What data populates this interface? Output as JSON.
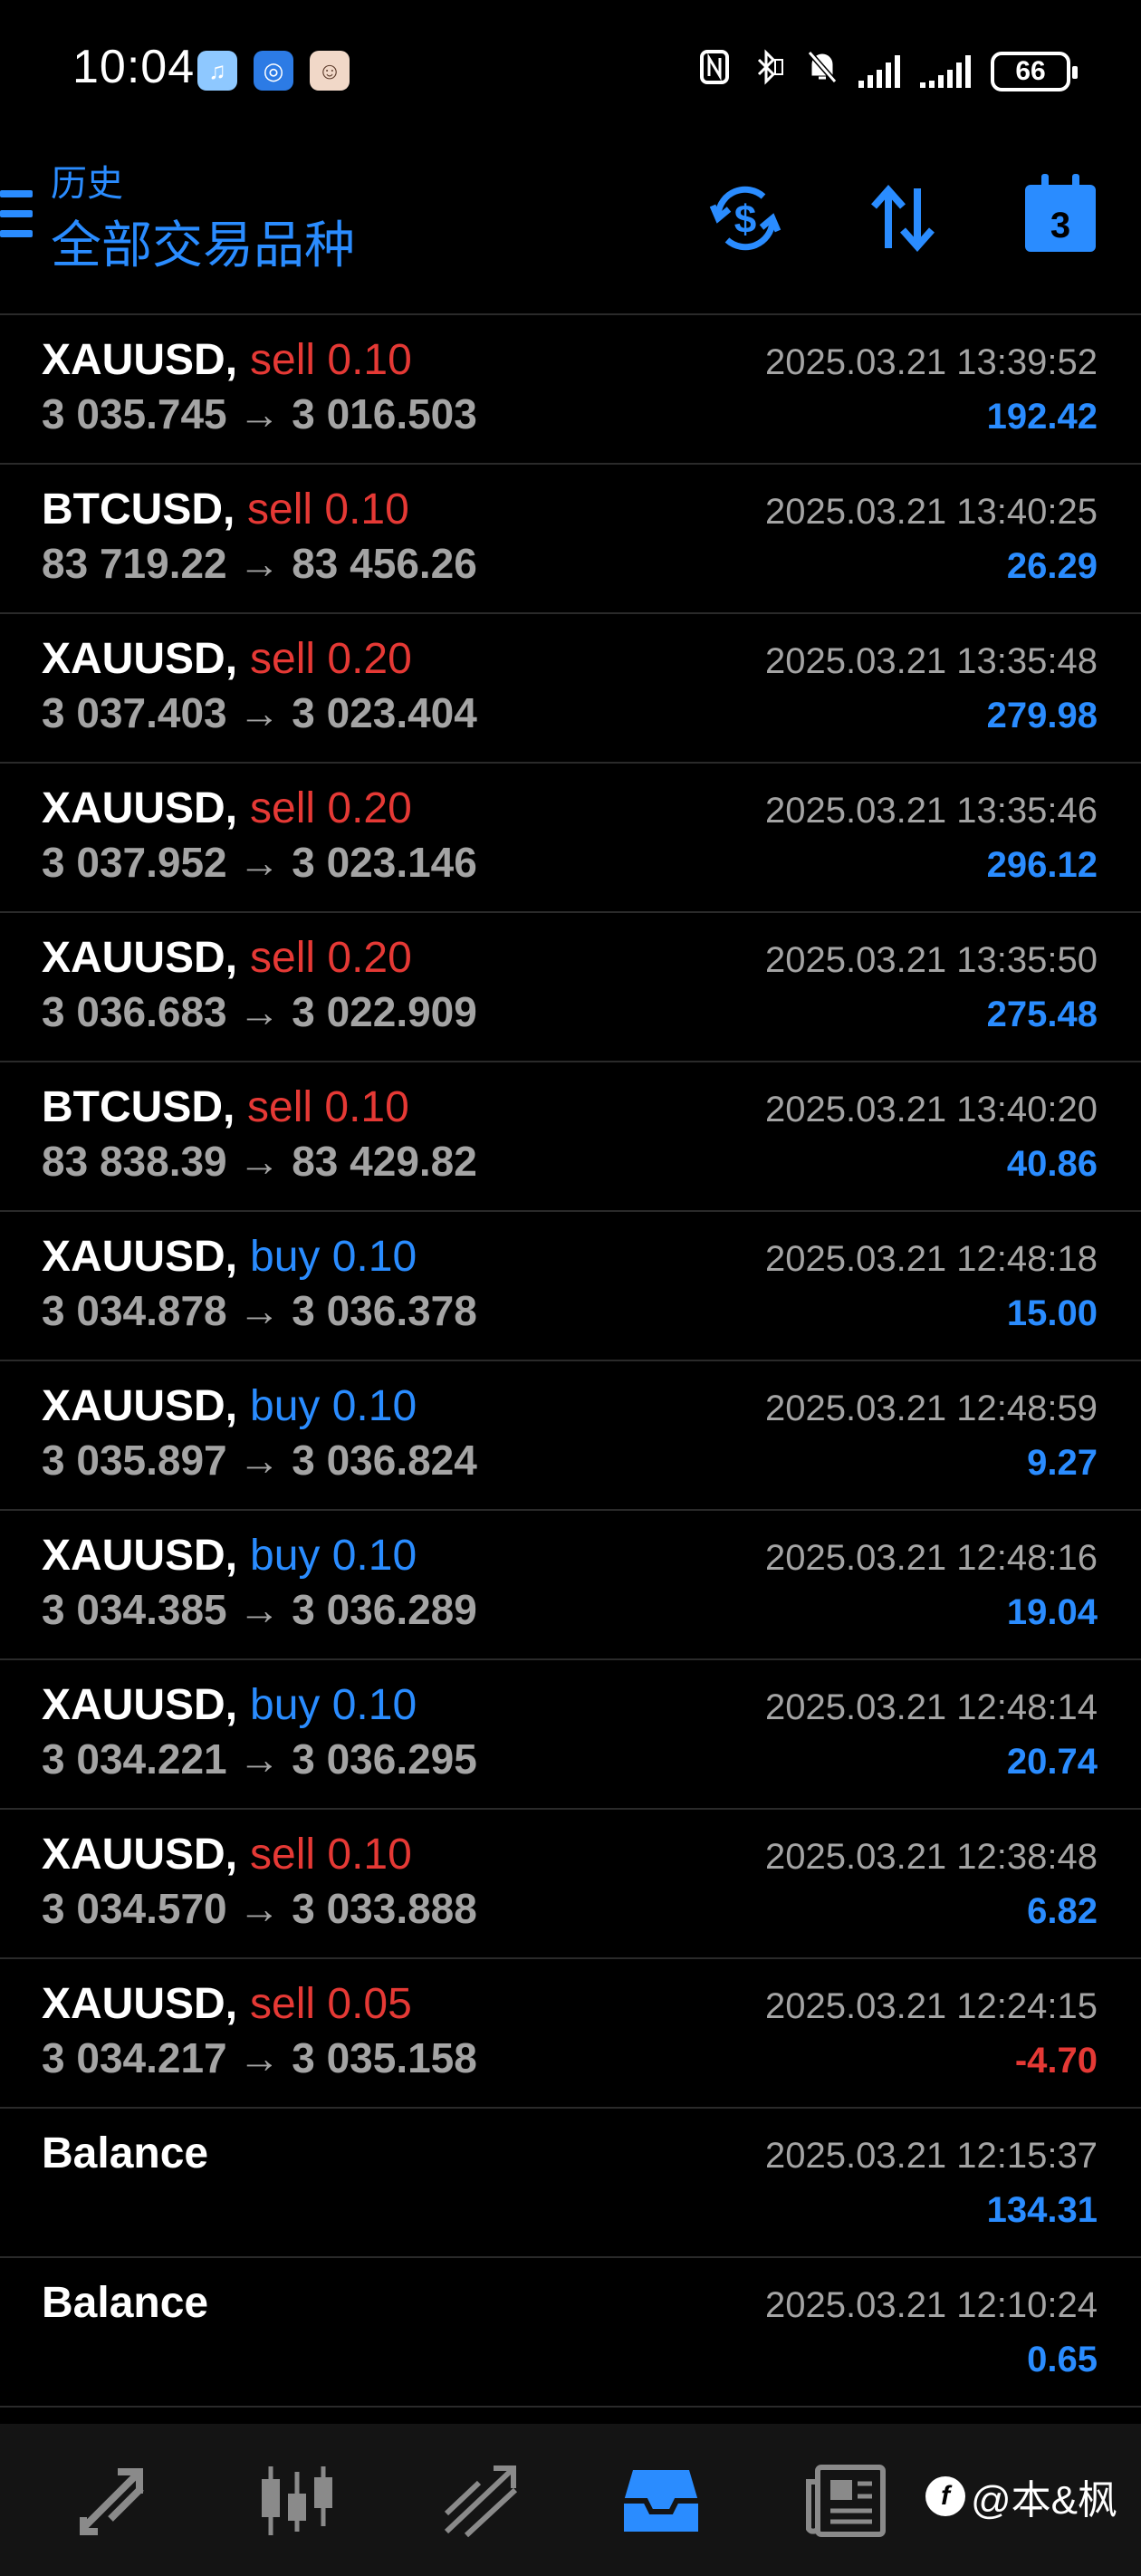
{
  "status_bar": {
    "time": "10:04",
    "battery": "66"
  },
  "header": {
    "subtitle": "历史",
    "title": "全部交易品种",
    "calendar_badge": "3"
  },
  "trades": [
    {
      "symbol": "XAUUSD,",
      "side": "sell",
      "side_type": "sell",
      "volume": "0.10",
      "prices": "3 035.745 → 3 016.503",
      "time": "2025.03.21 13:39:52",
      "profit": "192.42",
      "negative": false
    },
    {
      "symbol": "BTCUSD,",
      "side": "sell",
      "side_type": "sell",
      "volume": "0.10",
      "prices": "83 719.22 → 83 456.26",
      "time": "2025.03.21 13:40:25",
      "profit": "26.29",
      "negative": false
    },
    {
      "symbol": "XAUUSD,",
      "side": "sell",
      "side_type": "sell",
      "volume": "0.20",
      "prices": "3 037.403 → 3 023.404",
      "time": "2025.03.21 13:35:48",
      "profit": "279.98",
      "negative": false
    },
    {
      "symbol": "XAUUSD,",
      "side": "sell",
      "side_type": "sell",
      "volume": "0.20",
      "prices": "3 037.952 → 3 023.146",
      "time": "2025.03.21 13:35:46",
      "profit": "296.12",
      "negative": false
    },
    {
      "symbol": "XAUUSD,",
      "side": "sell",
      "side_type": "sell",
      "volume": "0.20",
      "prices": "3 036.683 → 3 022.909",
      "time": "2025.03.21 13:35:50",
      "profit": "275.48",
      "negative": false
    },
    {
      "symbol": "BTCUSD,",
      "side": "sell",
      "side_type": "sell",
      "volume": "0.10",
      "prices": "83 838.39 → 83 429.82",
      "time": "2025.03.21 13:40:20",
      "profit": "40.86",
      "negative": false
    },
    {
      "symbol": "XAUUSD,",
      "side": "buy",
      "side_type": "buy",
      "volume": "0.10",
      "prices": "3 034.878 → 3 036.378",
      "time": "2025.03.21 12:48:18",
      "profit": "15.00",
      "negative": false
    },
    {
      "symbol": "XAUUSD,",
      "side": "buy",
      "side_type": "buy",
      "volume": "0.10",
      "prices": "3 035.897 → 3 036.824",
      "time": "2025.03.21 12:48:59",
      "profit": "9.27",
      "negative": false
    },
    {
      "symbol": "XAUUSD,",
      "side": "buy",
      "side_type": "buy",
      "volume": "0.10",
      "prices": "3 034.385 → 3 036.289",
      "time": "2025.03.21 12:48:16",
      "profit": "19.04",
      "negative": false
    },
    {
      "symbol": "XAUUSD,",
      "side": "buy",
      "side_type": "buy",
      "volume": "0.10",
      "prices": "3 034.221 → 3 036.295",
      "time": "2025.03.21 12:48:14",
      "profit": "20.74",
      "negative": false
    },
    {
      "symbol": "XAUUSD,",
      "side": "sell",
      "side_type": "sell",
      "volume": "0.10",
      "prices": "3 034.570 → 3 033.888",
      "time": "2025.03.21 12:38:48",
      "profit": "6.82",
      "negative": false
    },
    {
      "symbol": "XAUUSD,",
      "side": "sell",
      "side_type": "sell",
      "volume": "0.05",
      "prices": "3 034.217 → 3 035.158",
      "time": "2025.03.21 12:24:15",
      "profit": "-4.70",
      "negative": true
    },
    {
      "symbol": "Balance",
      "side": "",
      "side_type": "none",
      "volume": "",
      "prices": "",
      "time": "2025.03.21 12:15:37",
      "profit": "134.31",
      "negative": false
    },
    {
      "symbol": "Balance",
      "side": "",
      "side_type": "none",
      "volume": "",
      "prices": "",
      "time": "2025.03.21 12:10:24",
      "profit": "0.65",
      "negative": false
    }
  ],
  "bottom_nav": {
    "items": [
      {
        "icon": "quotes-icon",
        "active": false
      },
      {
        "icon": "chart-icon",
        "active": false
      },
      {
        "icon": "trade-icon",
        "active": false
      },
      {
        "icon": "history-icon",
        "active": true
      },
      {
        "icon": "news-icon",
        "active": false
      }
    ],
    "watermark": "@本&枫"
  },
  "colors": {
    "accent": "#2a8cff",
    "sell": "#e53935",
    "muted": "#a4a4a4",
    "background": "#000000"
  }
}
